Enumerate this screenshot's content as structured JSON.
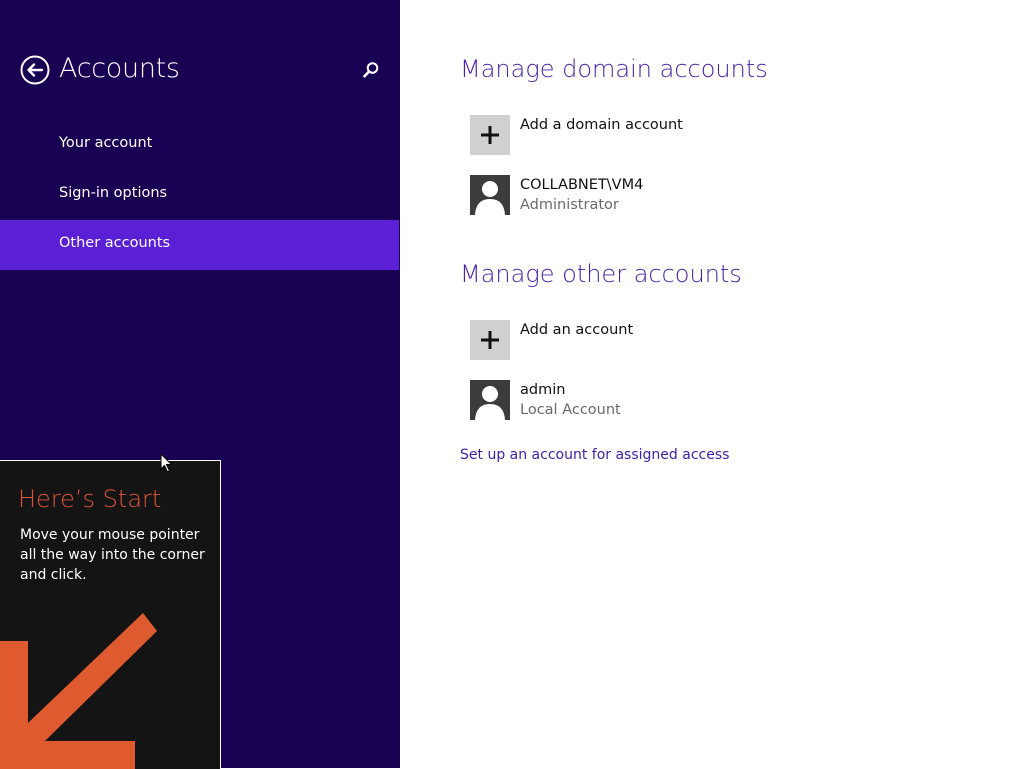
{
  "sidebar": {
    "title": "Accounts",
    "back_icon": "back-arrow-circle-icon",
    "search_icon": "search-icon",
    "items": [
      {
        "label": "Your account",
        "selected": false
      },
      {
        "label": "Sign-in options",
        "selected": false
      },
      {
        "label": "Other accounts",
        "selected": true
      }
    ]
  },
  "tip": {
    "title": "Here’s Start",
    "body": "Move your mouse pointer all the way into the corner and click.",
    "arrow_icon": "down-left-arrow-icon"
  },
  "domain_section": {
    "title": "Manage domain accounts",
    "add_label": "Add a domain account",
    "accounts": [
      {
        "name": "COLLABNET\\VM4",
        "type": "Administrator"
      }
    ]
  },
  "other_section": {
    "title": "Manage other accounts",
    "add_label": "Add an account",
    "accounts": [
      {
        "name": "admin",
        "type": "Local Account"
      }
    ]
  },
  "assigned_access_link": "Set up an account for assigned access",
  "colors": {
    "sidebar_bg": "#180052",
    "selected_bg": "#5b1fd6",
    "heading": "#4a22a8",
    "tip_title": "#e0543a",
    "arrow": "#e05a2f"
  }
}
